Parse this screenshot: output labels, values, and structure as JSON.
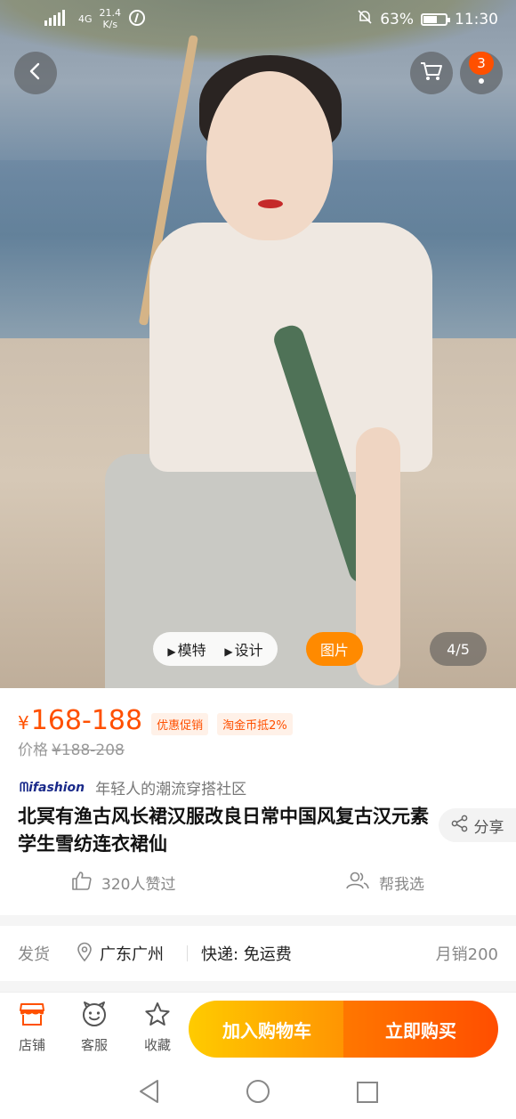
{
  "status_bar": {
    "network": "4G",
    "speed_value": "21.4",
    "speed_unit": "K/s",
    "battery": "63%",
    "time": "11:30",
    "battery_level": 0.63
  },
  "header": {
    "cart_badge": "3"
  },
  "gallery": {
    "model_label": "模特",
    "design_label": "设计",
    "picture_label": "图片",
    "page_indicator": "4/5"
  },
  "price": {
    "currency": "¥",
    "range": "168-188",
    "promo_tag": "优惠促销",
    "coin_tag": "淘金币抵2%",
    "original_label": "价格",
    "original_value": "¥188-208"
  },
  "brand": {
    "logo_text": "ifashion",
    "slogan": "年轻人的潮流穿搭社区"
  },
  "product": {
    "title": "北冥有渔古风长裙汉服改良日常中国风复古汉元素学生雪纺连衣裙仙",
    "share_label": "分享",
    "likes_label": "320人赞过",
    "help_label": "帮我选"
  },
  "shipping": {
    "label": "发货",
    "location": "广东广州",
    "delivery": "快递: 免运费",
    "monthly_sales": "月销200"
  },
  "action_bar": {
    "store_label": "店铺",
    "service_label": "客服",
    "favorite_label": "收藏",
    "add_to_cart_label": "加入购物车",
    "buy_now_label": "立即购买"
  },
  "colors": {
    "accent": "#ff5000",
    "cart_gradient_start": "#ffcb00",
    "buy_gradient_end": "#ff4e00"
  }
}
